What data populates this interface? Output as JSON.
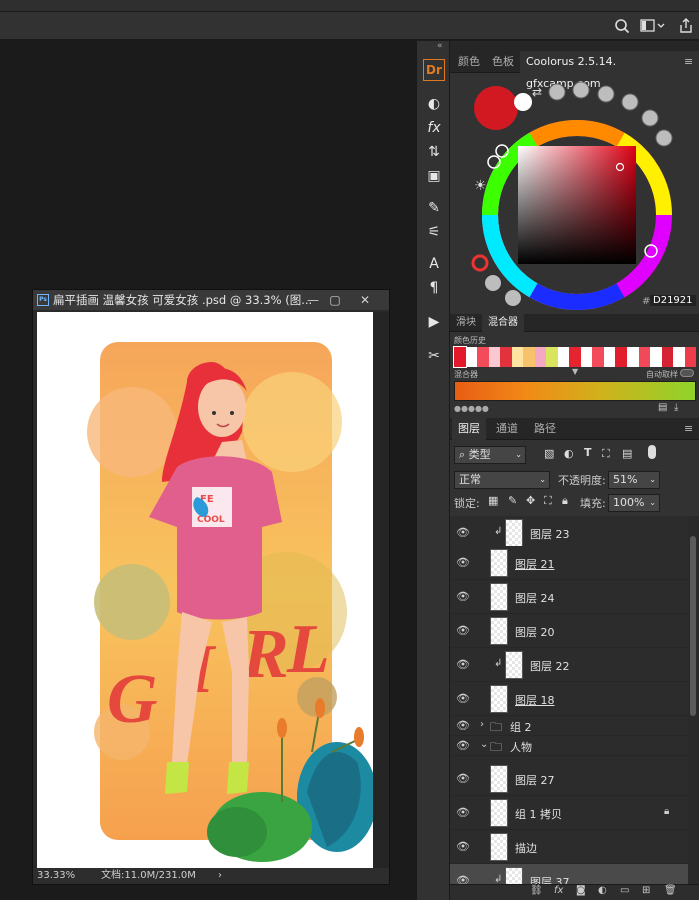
{
  "option_bar": {
    "search_icon": "search-icon",
    "workspace_icon": "workspace-icon",
    "share_icon": "share-icon"
  },
  "document": {
    "title": "扁平插画 温馨女孩 可爱女孩 .psd @ 33.3% (图...",
    "app_badge": "Ps",
    "zoom": "33.33%",
    "doc_info": "文档:11.0M/231.0M",
    "status_arrow": "›"
  },
  "colorpanel": {
    "tabs": [
      "颜色",
      "色板",
      "Coolorus 2.5.14. gfxcamp.com"
    ],
    "hex_prefix": "#",
    "hex_value": "D21921",
    "foreground": "#d21921",
    "background": "#ffffff"
  },
  "mixer": {
    "tabs": [
      "滑块",
      "混合器"
    ],
    "history_label": "颜色历史",
    "mixer_label": "混合器",
    "auto_label": "自动取样",
    "history_swatches": [
      "#e31a2b",
      "#ffffff",
      "#f44b5a",
      "#f9c8d0",
      "#e2323c",
      "#ffe3a1",
      "#f6c26b",
      "#f4a8c3",
      "#d9e45f",
      "#ffffff",
      "#e6242f",
      "#ffffff",
      "#f14b5c",
      "#ffffff",
      "#e21d2c",
      "#ffffff",
      "#f0495a",
      "#ffffff",
      "#d62333",
      "#ffffff",
      "#ed3d4d"
    ]
  },
  "layers": {
    "tabs": [
      "图层",
      "通道",
      "路径"
    ],
    "filter_kind": "类型",
    "blend_mode": "正常",
    "opacity_label": "不透明度:",
    "opacity_value": "51%",
    "lock_label": "锁定:",
    "fill_label": "填充:",
    "fill_value": "100%",
    "items": [
      {
        "name": "图层 23",
        "clip": true,
        "group": false,
        "expanded": false,
        "underline": false,
        "locked": false
      },
      {
        "name": "图层 21",
        "clip": false,
        "group": false,
        "expanded": false,
        "underline": true,
        "locked": false
      },
      {
        "name": "图层 24",
        "clip": false,
        "group": false,
        "expanded": false,
        "underline": false,
        "locked": false
      },
      {
        "name": "图层 20",
        "clip": false,
        "group": false,
        "expanded": false,
        "underline": false,
        "locked": false
      },
      {
        "name": "图层 22",
        "clip": true,
        "group": false,
        "expanded": false,
        "underline": false,
        "locked": false
      },
      {
        "name": "图层 18",
        "clip": false,
        "group": false,
        "expanded": false,
        "underline": true,
        "locked": false
      },
      {
        "name": "组 2",
        "clip": false,
        "group": true,
        "expanded": false,
        "underline": false,
        "locked": false
      },
      {
        "name": "人物",
        "clip": false,
        "group": true,
        "expanded": true,
        "underline": false,
        "locked": false
      },
      {
        "name": "图层 27",
        "clip": false,
        "group": false,
        "expanded": false,
        "underline": false,
        "locked": false
      },
      {
        "name": "组 1 拷贝",
        "clip": false,
        "group": false,
        "expanded": false,
        "underline": false,
        "locked": true
      },
      {
        "name": "描边",
        "clip": false,
        "group": false,
        "expanded": false,
        "underline": false,
        "locked": false
      },
      {
        "name": "图层 37",
        "clip": true,
        "group": false,
        "expanded": false,
        "underline": false,
        "locked": false
      }
    ]
  },
  "artwork": {
    "word": "GIRL",
    "tee_text_1": "FE",
    "tee_text_2": "COOL"
  }
}
